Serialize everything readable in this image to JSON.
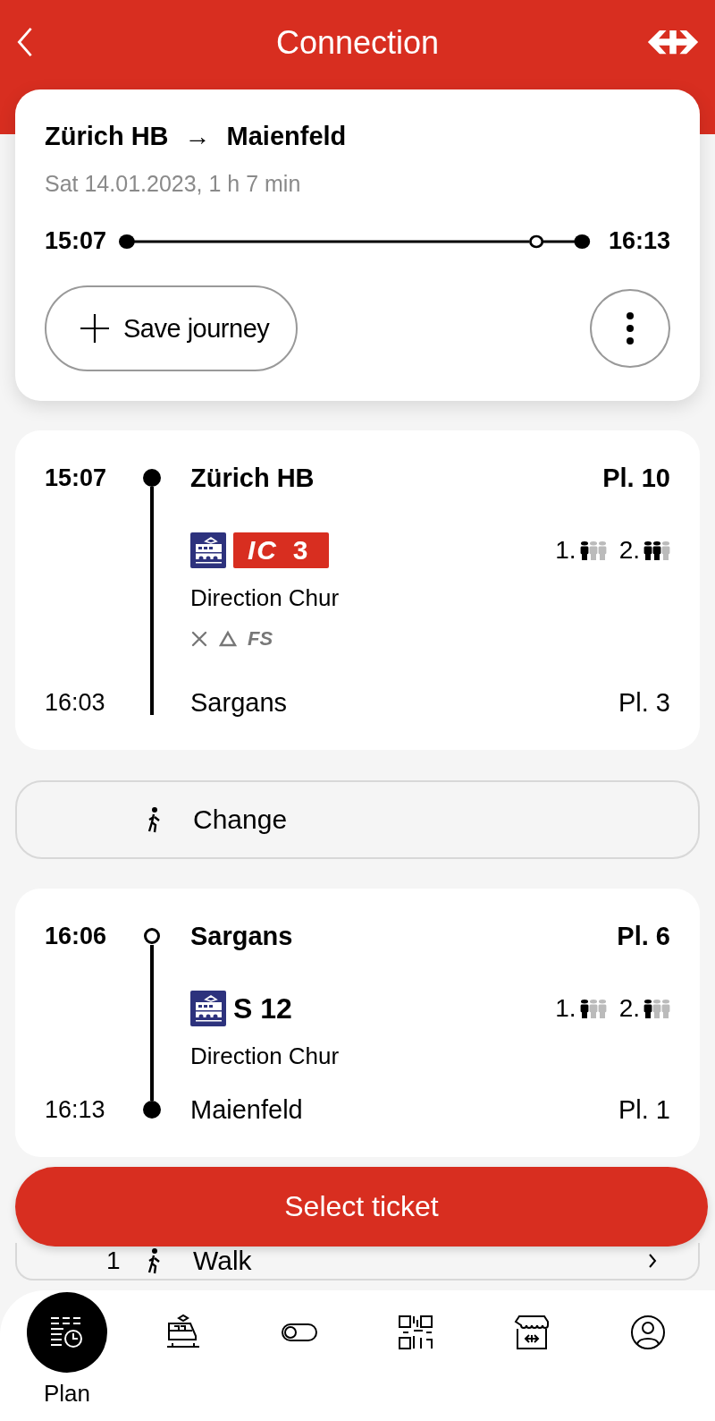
{
  "header": {
    "title": "Connection"
  },
  "summary": {
    "from": "Zürich HB",
    "arrow": "→",
    "to": "Maienfeld",
    "subtitle": "Sat 14.01.2023, 1 h 7 min",
    "departure": "15:07",
    "arrival": "16:13",
    "save_label": "Save journey"
  },
  "sections": [
    {
      "kind": "leg",
      "dep_time": "15:07",
      "dep_station": "Zürich HB",
      "dep_platform": "Pl. 10",
      "start_hollow": false,
      "end_dot": false,
      "product": {
        "kind": "ic",
        "name": "IC",
        "number": "3"
      },
      "classes": [
        {
          "label": "1.",
          "level": 0.33
        },
        {
          "label": "2.",
          "level": 0.67
        }
      ],
      "direction": "Direction Chur",
      "attributes": [
        {
          "kind": "restaurant"
        },
        {
          "kind": "triangle"
        },
        {
          "kind": "text",
          "text": "FS"
        }
      ],
      "arr_time": "16:03",
      "arr_station": "Sargans",
      "arr_platform": "Pl. 3"
    },
    {
      "kind": "change",
      "label": "Change"
    },
    {
      "kind": "leg",
      "dep_time": "16:06",
      "dep_station": "Sargans",
      "dep_platform": "Pl. 6",
      "start_hollow": true,
      "end_dot": true,
      "product": {
        "kind": "s",
        "name": "S 12"
      },
      "classes": [
        {
          "label": "1.",
          "level": 0.33
        },
        {
          "label": "2.",
          "level": 0.33
        }
      ],
      "direction": "Direction Chur",
      "arr_time": "16:13",
      "arr_station": "Maienfeld",
      "arr_platform": "Pl. 1"
    },
    {
      "kind": "walk",
      "duration": "1",
      "label": "Walk"
    }
  ],
  "select_button": "Select ticket",
  "nav": [
    {
      "kind": "plan",
      "label": "Plan",
      "selected": true
    },
    {
      "kind": "train",
      "selected": false
    },
    {
      "kind": "toggle",
      "selected": false
    },
    {
      "kind": "qr",
      "selected": false
    },
    {
      "kind": "shop",
      "selected": false
    },
    {
      "kind": "profile",
      "selected": false
    }
  ]
}
